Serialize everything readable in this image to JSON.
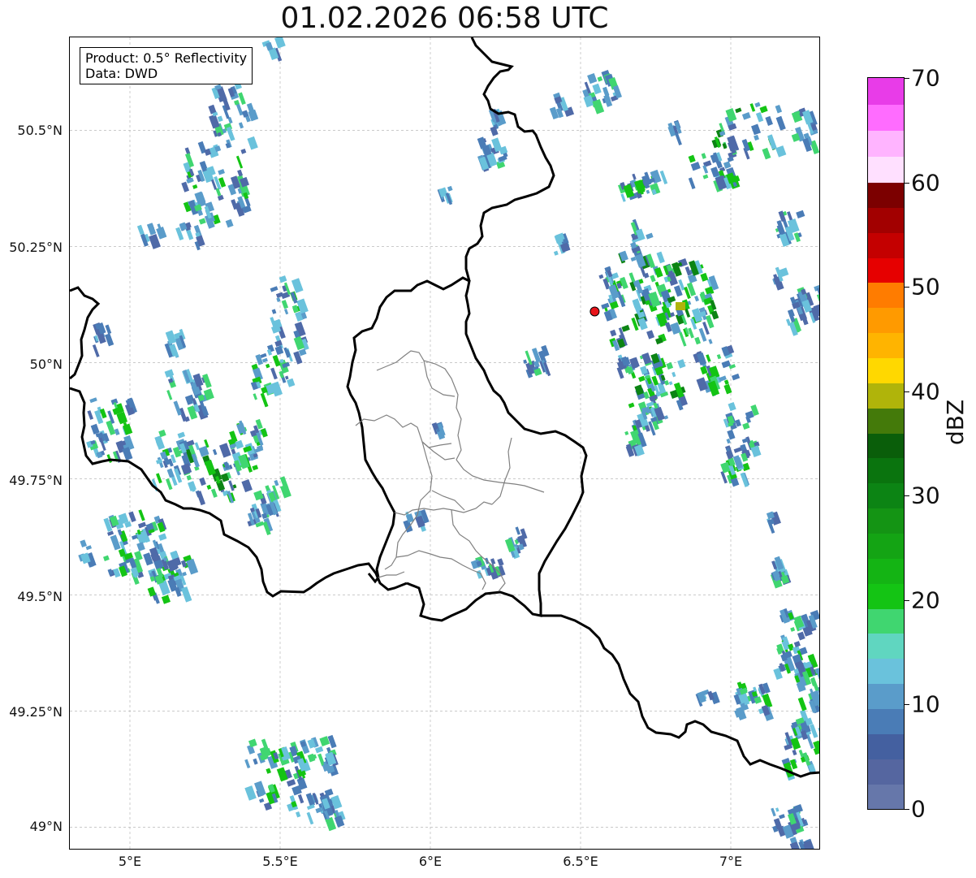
{
  "title": "01.02.2026 06:58 UTC",
  "info_box": {
    "product_line": "Product: 0.5° Reflectivity",
    "data_line": "Data: DWD"
  },
  "map": {
    "lon_range": [
      4.8,
      7.3
    ],
    "lat_range": [
      48.95,
      50.7
    ],
    "x_ticks": [
      "5°E",
      "5.5°E",
      "6°E",
      "6.5°E",
      "7°E"
    ],
    "y_ticks": [
      "50.5°N",
      "50.25°N",
      "50°N",
      "49.75°N",
      "49.5°N",
      "49.25°N",
      "49°N"
    ],
    "radar_site": {
      "lon": 6.547,
      "lat": 50.11,
      "color": "#e8141a"
    },
    "gridlines": true
  },
  "colorbar": {
    "label": "dBZ",
    "ticks": [
      "0",
      "10",
      "20",
      "30",
      "40",
      "50",
      "60",
      "70"
    ],
    "range": [
      0,
      70
    ],
    "colors": [
      "#6677aa",
      "#5566a0",
      "#4460a0",
      "#4a7cb6",
      "#5a9cca",
      "#6ac2dc",
      "#60d6c0",
      "#40d670",
      "#14c414",
      "#14b414",
      "#14a414",
      "#149414",
      "#0c8414",
      "#0a740e",
      "#0a5e0a",
      "#447a0a",
      "#b0b40a",
      "#ffd800",
      "#ffb400",
      "#ff9a00",
      "#ff7c00",
      "#e60000",
      "#c40000",
      "#a20000",
      "#7c0000",
      "#ffe0ff",
      "#ffb4ff",
      "#ff6cff",
      "#e83ce8"
    ]
  },
  "echo_palette": [
    "#4f6aa8",
    "#4a7cb6",
    "#5a9cca",
    "#6ac2dc",
    "#40d670",
    "#14c414",
    "#0c8414"
  ]
}
